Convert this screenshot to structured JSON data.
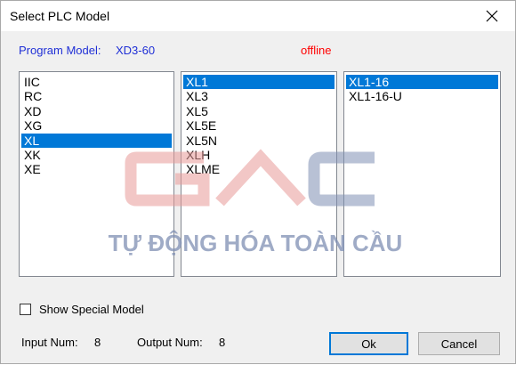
{
  "window": {
    "title": "Select PLC Model",
    "close_icon": "close-icon"
  },
  "header": {
    "program_model_label": "Program Model:",
    "program_model_value": "XD3-60",
    "status": "offline"
  },
  "series_list": {
    "items": [
      "IIC",
      "RC",
      "XD",
      "XG",
      "XL",
      "XK",
      "XE"
    ],
    "selected": "XL"
  },
  "model_list": {
    "items": [
      "XL1",
      "XL3",
      "XL5",
      "XL5E",
      "XL5N",
      "XLH",
      "XLME"
    ],
    "selected": "XL1"
  },
  "variant_list": {
    "items": [
      "XL1-16",
      "XL1-16-U"
    ],
    "selected": "XL1-16"
  },
  "options": {
    "show_special_model_label": "Show Special Model",
    "show_special_model_checked": false
  },
  "io": {
    "input_label": "Input Num:",
    "input_value": "8",
    "output_label": "Output Num:",
    "output_value": "8"
  },
  "buttons": {
    "ok_label": "Ok",
    "cancel_label": "Cancel"
  },
  "watermark": {
    "logo_text": "GAC",
    "tagline": "TỰ ĐỘNG HÓA TOÀN CẦU"
  },
  "colors": {
    "selection": "#0078d7",
    "label_blue": "#1f2fd6",
    "status_red": "#ff0000",
    "watermark_red": "#e89a98",
    "watermark_blue": "#7f8fb4"
  }
}
